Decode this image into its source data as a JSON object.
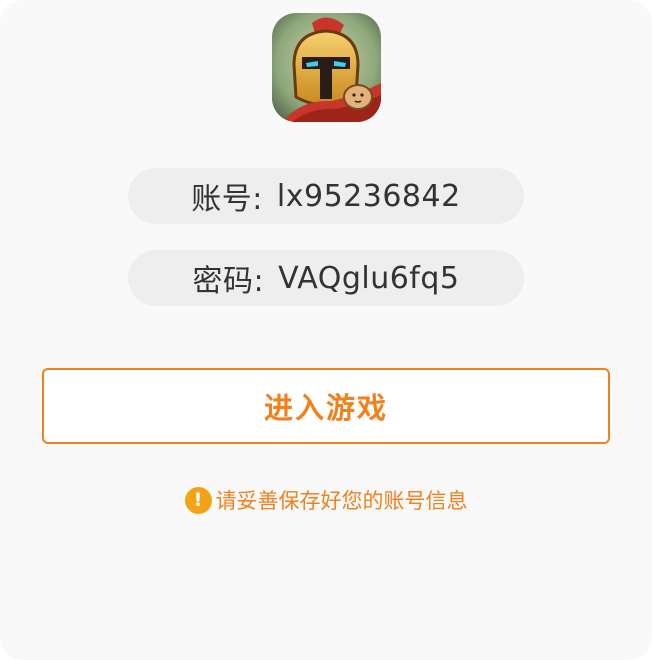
{
  "app": {
    "icon": "spartan-helmet-app-icon"
  },
  "account": {
    "label": "账号:",
    "value": "lx95236842"
  },
  "password": {
    "label": "密码:",
    "value": "VAQglu6fq5"
  },
  "actions": {
    "enter_label": "进入游戏"
  },
  "notice": {
    "icon": "warning-icon",
    "text": "请妥善保存好您的账号信息"
  },
  "colors": {
    "accent": "#f2811d",
    "warning": "#f5a316",
    "pill_bg": "#eeeeee",
    "text": "#333333"
  }
}
